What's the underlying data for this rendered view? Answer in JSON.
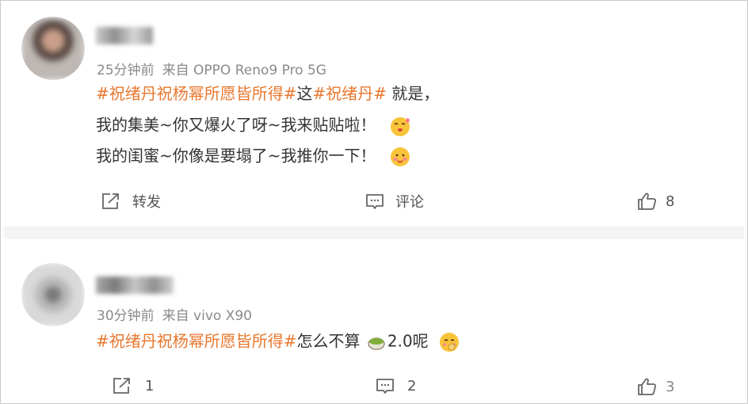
{
  "comments": [
    {
      "time": "25分钟前",
      "source": "来自 OPPO Reno9 Pro 5G",
      "lines": [
        {
          "tag1": "#祝绪丹祝杨幂所愿皆所得#",
          "text1": "这",
          "tag2": "#祝绪丹#",
          "text2": " 就是，"
        },
        {
          "text": "我的集美~你又爆火了呀~我来贴贴啦！"
        },
        {
          "text": "我的闺蜜~你像是要塌了~我推你一下！"
        }
      ],
      "actions": {
        "repost": "转发",
        "comment": "评论",
        "likes": "8"
      }
    },
    {
      "time": "30分钟前",
      "source": "来自 vivo X90",
      "tag": "#祝绪丹祝杨幂所愿皆所得#",
      "text_before": "怎么不算",
      "text_after": "2.0呢",
      "actions": {
        "repost": "1",
        "comment": "2",
        "likes": "3"
      }
    }
  ],
  "colors": {
    "tag": "#e8772e",
    "meta": "#8a8a8a",
    "divider": "#f4f4f4"
  },
  "icons": [
    "repost-icon",
    "comment-icon",
    "like-icon",
    "emoji-kiss-icon",
    "emoji-shy-icon",
    "emoji-matcha-icon",
    "emoji-cute-icon"
  ]
}
